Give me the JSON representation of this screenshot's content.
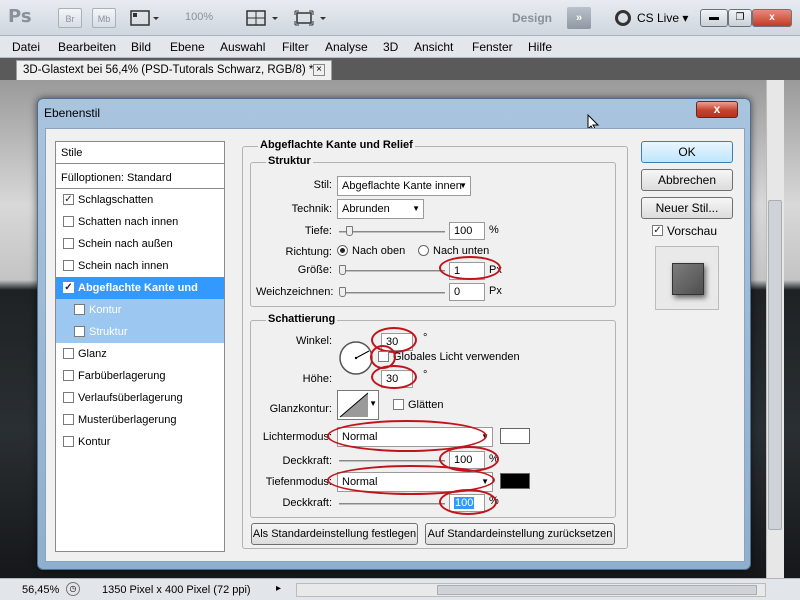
{
  "appbar": {
    "logo": "Ps",
    "btn_br": "Br",
    "btn_mb": "Mb",
    "zoom": "100%",
    "design": "Design",
    "next": "»",
    "cslive": "CS Live"
  },
  "menu": [
    "Datei",
    "Bearbeiten",
    "Bild",
    "Ebene",
    "Auswahl",
    "Filter",
    "Analyse",
    "3D",
    "Ansicht",
    "Fenster",
    "Hilfe"
  ],
  "document": {
    "tab_title": "3D-Glastext bei 56,4% (PSD-Tutorals Schwarz, RGB/8) *",
    "tab_close": "×"
  },
  "status": {
    "zoom": "56,45%",
    "info": "1350 Pixel x 400 Pixel (72 ppi)"
  },
  "dialog": {
    "title": "Ebenenstil",
    "close": "x",
    "styles_header": "Stile",
    "fill_options": "Fülloptionen: Standard",
    "style_items": [
      {
        "label": "Schlagschatten",
        "checked": true
      },
      {
        "label": "Schatten nach innen",
        "checked": false
      },
      {
        "label": "Schein nach außen",
        "checked": false
      },
      {
        "label": "Schein nach innen",
        "checked": false
      },
      {
        "label": "Abgeflachte Kante und Relief",
        "checked": true
      },
      {
        "label": "Kontur",
        "checked": false
      },
      {
        "label": "Struktur",
        "checked": false
      },
      {
        "label": "Glanz",
        "checked": false
      },
      {
        "label": "Farbüberlagerung",
        "checked": false
      },
      {
        "label": "Verlaufsüberlagerung",
        "checked": false
      },
      {
        "label": "Musterüberlagerung",
        "checked": false
      },
      {
        "label": "Kontur",
        "checked": false
      }
    ],
    "section_title": "Abgeflachte Kante und Relief",
    "structure": {
      "title": "Struktur",
      "style_label": "Stil:",
      "style_value": "Abgeflachte Kante innen",
      "technique_label": "Technik:",
      "technique_value": "Abrunden",
      "depth_label": "Tiefe:",
      "depth_value": "100",
      "depth_unit": "%",
      "direction_label": "Richtung:",
      "direction_up": "Nach oben",
      "direction_down": "Nach unten",
      "size_label": "Größe:",
      "size_value": "1",
      "size_unit": "Px",
      "soften_label": "Weichzeichnen:",
      "soften_value": "0",
      "soften_unit": "Px"
    },
    "shading": {
      "title": "Schattierung",
      "angle_label": "Winkel:",
      "angle_value": "30",
      "angle_unit": "°",
      "global_light": "Globales Licht verwenden",
      "altitude_label": "Höhe:",
      "altitude_value": "30",
      "altitude_unit": "°",
      "gloss_contour_label": "Glanzkontur:",
      "antialiased": "Glätten",
      "highlight_mode_label": "Lichtermodus:",
      "highlight_mode_value": "Normal",
      "highlight_opacity_label": "Deckkraft:",
      "highlight_opacity_value": "100",
      "highlight_opacity_unit": "%",
      "shadow_mode_label": "Tiefenmodus:",
      "shadow_mode_value": "Normal",
      "shadow_opacity_label": "Deckkraft:",
      "shadow_opacity_value": "100",
      "shadow_opacity_unit": "%",
      "highlight_color": "#ffffff",
      "shadow_color": "#000000"
    },
    "make_default": "Als Standardeinstellung festlegen",
    "reset_default": "Auf Standardeinstellung zurücksetzen",
    "ok": "OK",
    "cancel": "Abbrechen",
    "new_style": "Neuer Stil...",
    "preview": "Vorschau"
  }
}
